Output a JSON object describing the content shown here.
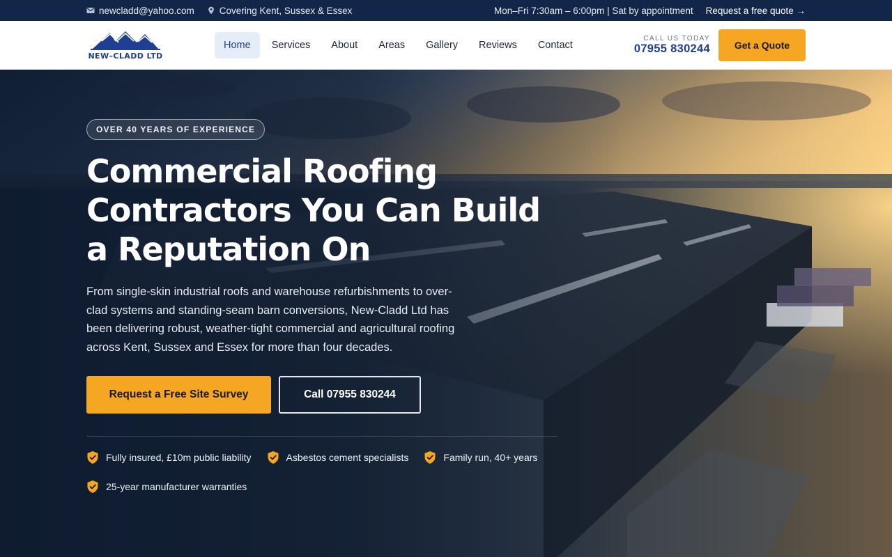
{
  "topbar": {
    "email": "newcladd@yahoo.com",
    "location": "Covering Kent, Sussex & Essex",
    "hours": "Mon–Fri 7:30am – 6:00pm | Sat by appointment",
    "quote_link": "Request a free quote →"
  },
  "brand": {
    "name": "NEW–CLADD LTD",
    "primary_color": "#1f3f92",
    "accent_color": "#f5a623",
    "dark_color": "#12264a"
  },
  "nav": {
    "items": [
      {
        "label": "Home",
        "active": true
      },
      {
        "label": "Services"
      },
      {
        "label": "About"
      },
      {
        "label": "Areas"
      },
      {
        "label": "Gallery"
      },
      {
        "label": "Reviews"
      },
      {
        "label": "Contact"
      }
    ],
    "call_label": "CALL US TODAY",
    "call_number": "07955 830244",
    "quote_button": "Get a Quote"
  },
  "hero": {
    "badge": "OVER 40 YEARS OF EXPERIENCE",
    "title": "Commercial Roofing Contractors You Can Build a Reputation On",
    "subtitle": "From single-skin industrial roofs and warehouse refurbishments to over-clad systems and standing-seam barn conversions, New-Cladd Ltd has been delivering robust, weather-tight commercial and agricultural roofing across Kent, Sussex and Essex for more than four decades.",
    "cta_primary": "Request a Free Site Survey",
    "cta_secondary": "Call 07955 830244",
    "features": [
      "Fully insured, £10m public liability",
      "Asbestos cement specialists",
      "Family run, 40+ years",
      "25-year manufacturer warranties"
    ]
  },
  "icons": {
    "email": "mail-icon",
    "location": "map-pin-icon",
    "feature": "shield-check-icon",
    "logo": "roof-peaks-logo"
  }
}
